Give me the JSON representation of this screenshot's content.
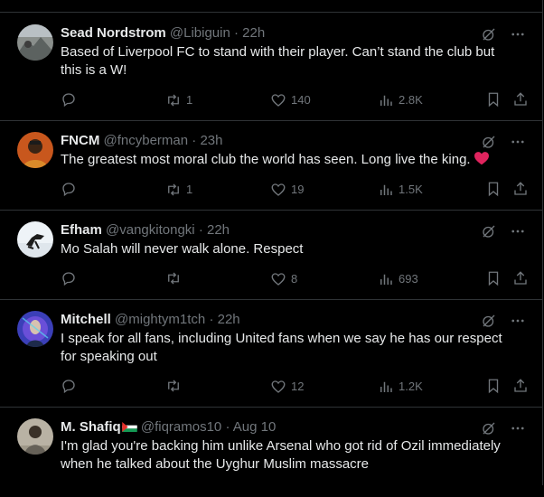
{
  "tweets": [
    {
      "name": "Sead Nordstrom",
      "handle": "@Libiguin",
      "time": "22h",
      "text": "Based of Liverpool FC to stand with their player. Can’t stand the club but this is a W!",
      "replies": "",
      "retweets": "1",
      "likes": "140",
      "views": "2.8K"
    },
    {
      "name": "FNCM",
      "handle": "@fncyberman",
      "time": "23h",
      "text": "The greatest most moral club the world has seen. Long live the king.",
      "replies": "",
      "retweets": "1",
      "likes": "19",
      "views": "1.5K"
    },
    {
      "name": "Efham",
      "handle": "@vangkitongki",
      "time": "22h",
      "text": "Mo Salah will never walk alone. Respect",
      "replies": "",
      "retweets": "",
      "likes": "8",
      "views": "693"
    },
    {
      "name": "Mitchell",
      "handle": "@mightym1tch",
      "time": "22h",
      "text": "I speak for all fans, including United fans when we say he has our respect for speaking out",
      "replies": "",
      "retweets": "",
      "likes": "12",
      "views": "1.2K"
    },
    {
      "name": "M. Shafiq",
      "handle": "@fiqramos10",
      "time": "Aug 10",
      "text": "I'm glad you're backing him unlike Arsenal who got rid of Ozil immediately when he talked about the Uyghur Muslim massacre",
      "replies": "",
      "retweets": "",
      "likes": "",
      "views": ""
    }
  ],
  "separator": "·",
  "colors": {
    "background": "#000000",
    "text": "#e7e9ea",
    "secondary": "#71767b",
    "border": "#2f3336",
    "heart_emoji": "#e0245e"
  },
  "icons": [
    "grok-icon",
    "more-icon",
    "reply-icon",
    "retweet-icon",
    "like-icon",
    "views-icon",
    "bookmark-icon",
    "share-icon"
  ]
}
